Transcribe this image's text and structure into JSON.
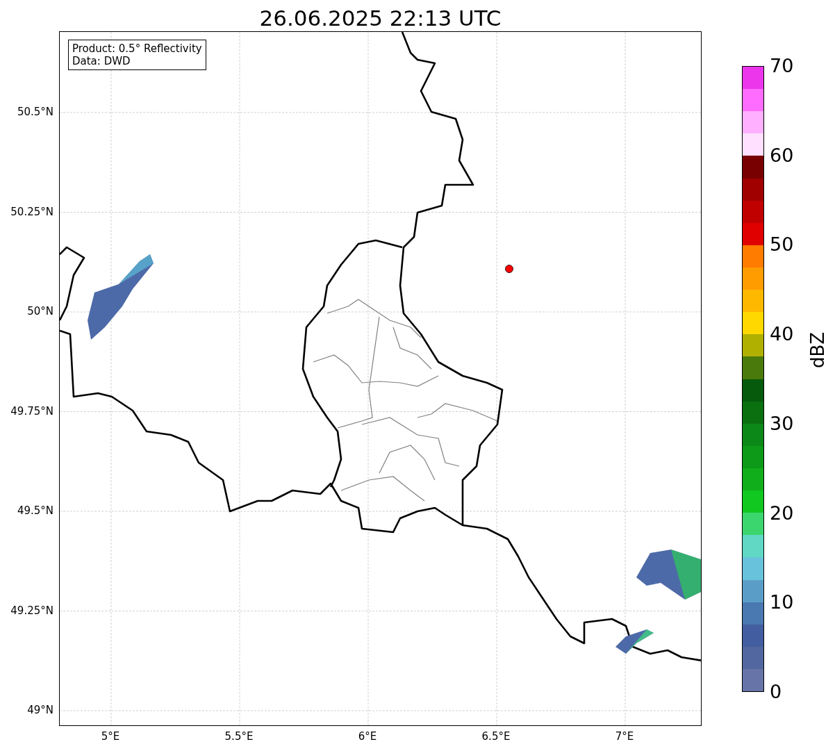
{
  "title": "26.06.2025 22:13 UTC",
  "map": {
    "info_box": [
      "Product: 0.5° Reflectivity",
      "Data: DWD"
    ],
    "lat_ticks": [
      "50.5°N",
      "50.25°N",
      "50°N",
      "49.75°N",
      "49.5°N",
      "49.25°N",
      "49°N"
    ],
    "lon_ticks": [
      "5°E",
      "5.5°E",
      "6°E",
      "6.5°E",
      "7°E"
    ]
  },
  "colorbar": {
    "label": "dBZ",
    "ticks": [
      "70",
      "60",
      "50",
      "40",
      "30",
      "20",
      "10",
      "0"
    ],
    "bins": [
      {
        "color": "#ec36ec"
      },
      {
        "color": "#ff6cff"
      },
      {
        "color": "#ffb0ff"
      },
      {
        "color": "#ffe0ff"
      },
      {
        "color": "#780000"
      },
      {
        "color": "#a00000"
      },
      {
        "color": "#c00000"
      },
      {
        "color": "#e00000"
      },
      {
        "color": "#ff7c00"
      },
      {
        "color": "#ff9c00"
      },
      {
        "color": "#ffb800"
      },
      {
        "color": "#ffd800"
      },
      {
        "color": "#b0b000"
      },
      {
        "color": "#4a7a0c"
      },
      {
        "color": "#065a0c"
      },
      {
        "color": "#0a7010"
      },
      {
        "color": "#0c8818"
      },
      {
        "color": "#0c9a18"
      },
      {
        "color": "#10ae1a"
      },
      {
        "color": "#10c820"
      },
      {
        "color": "#3cd66e"
      },
      {
        "color": "#60d8c4"
      },
      {
        "color": "#68c2dc"
      },
      {
        "color": "#5a9ec8"
      },
      {
        "color": "#4a78b0"
      },
      {
        "color": "#435ea0"
      },
      {
        "color": "#52679f"
      },
      {
        "color": "#6674a8"
      }
    ]
  }
}
